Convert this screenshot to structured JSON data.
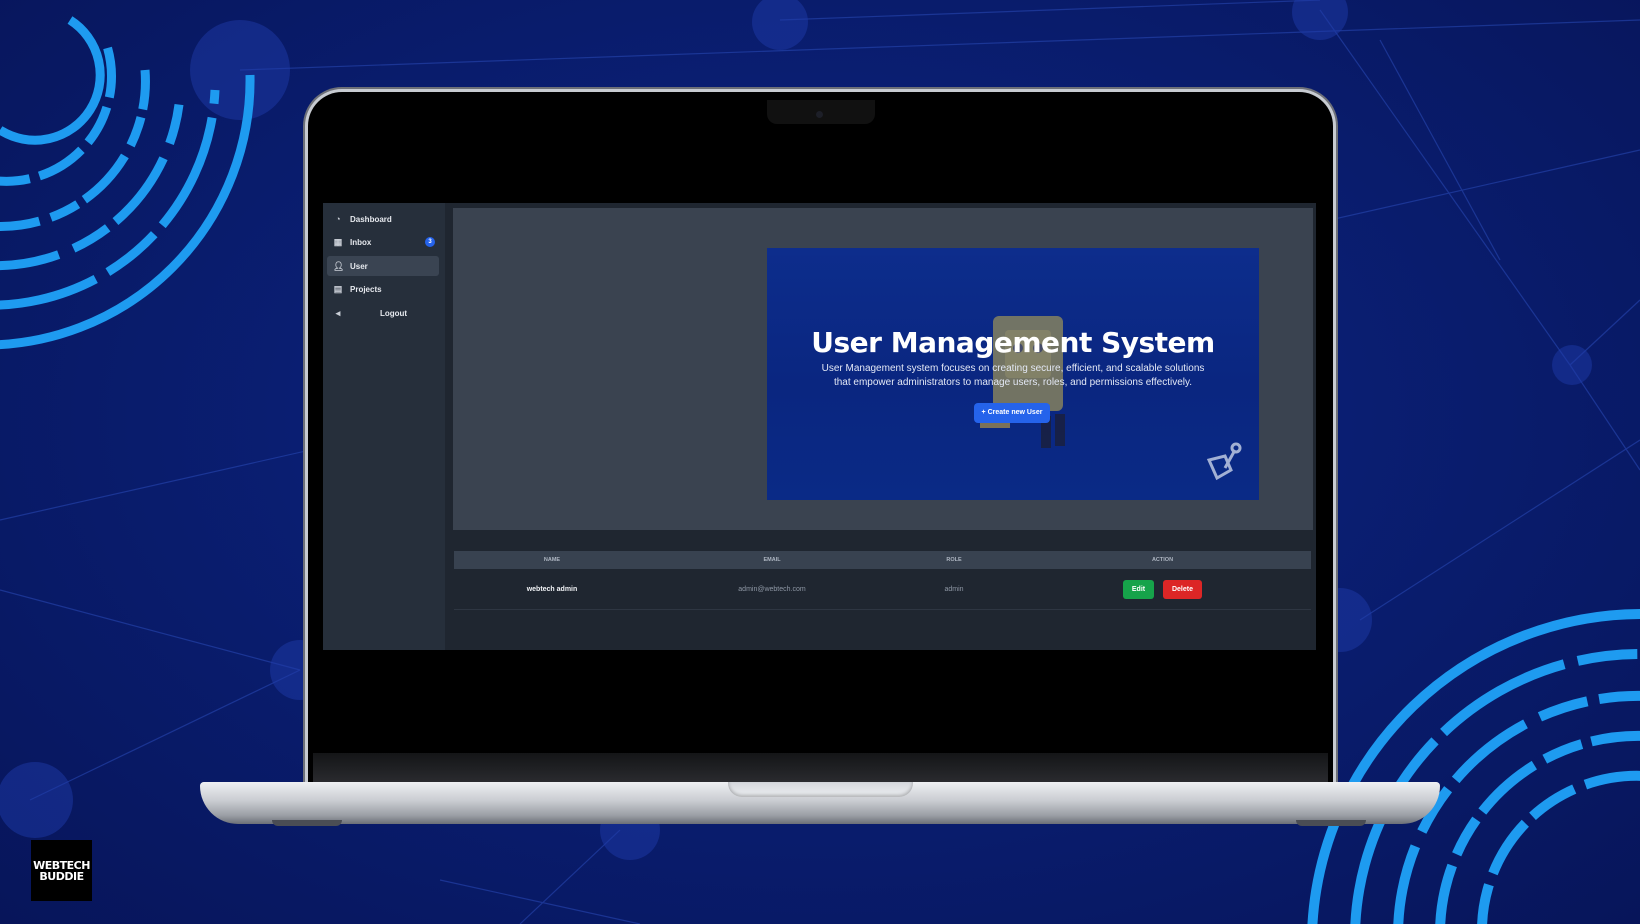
{
  "brand": {
    "line1": "WEBTECH",
    "line2": "BUDDIE"
  },
  "sidebar": {
    "items": [
      {
        "label": "Dashboard",
        "icon": "dashboard-icon"
      },
      {
        "label": "Inbox",
        "icon": "inbox-icon",
        "badge": "3"
      },
      {
        "label": "User",
        "icon": "user-icon",
        "active": true
      },
      {
        "label": "Projects",
        "icon": "projects-icon"
      },
      {
        "label": "Logout",
        "icon": "logout-icon"
      }
    ]
  },
  "hero": {
    "title": "User Management System",
    "description": "User Management system focuses on creating secure, efficient, and scalable solutions that empower administrators to manage users, roles, and permissions effectively.",
    "create_button": "+ Create new User"
  },
  "table": {
    "headers": [
      "NAME",
      "EMAIL",
      "ROLE",
      "ACTION"
    ],
    "rows": [
      {
        "name": "webtech admin",
        "email": "admin@webtech.com",
        "role": "admin",
        "edit": "Edit",
        "delete": "Delete"
      }
    ]
  },
  "colors": {
    "background": "#0a1f74",
    "accent": "#2563eb",
    "edit": "#16a34a",
    "delete": "#dc2626",
    "arc": "#1e9bf0"
  }
}
